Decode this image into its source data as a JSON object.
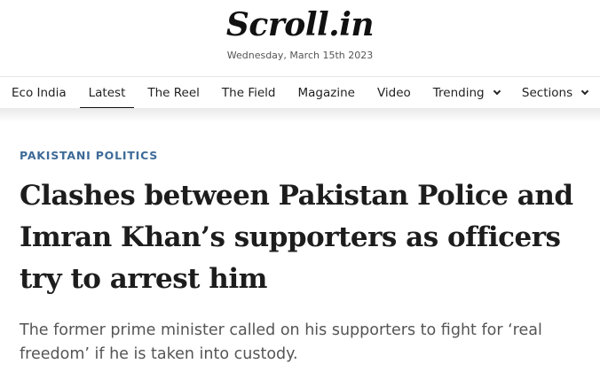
{
  "header": {
    "logo": "Scroll.in",
    "date": "Wednesday, March 15th 2023"
  },
  "nav": {
    "items": [
      {
        "label": "Eco India"
      },
      {
        "label": "Latest"
      },
      {
        "label": "The Reel"
      },
      {
        "label": "The Field"
      },
      {
        "label": "Magazine"
      },
      {
        "label": "Video"
      },
      {
        "label": "Trending"
      },
      {
        "label": "Sections"
      }
    ]
  },
  "article": {
    "category": "PAKISTANI POLITICS",
    "headline": "Clashes between Pakistan Police and Imran Khan’s supporters as officers try to arrest him",
    "standfirst": "The former prime minister called on his supporters to fight for ‘real freedom’ if he is taken into custody."
  }
}
